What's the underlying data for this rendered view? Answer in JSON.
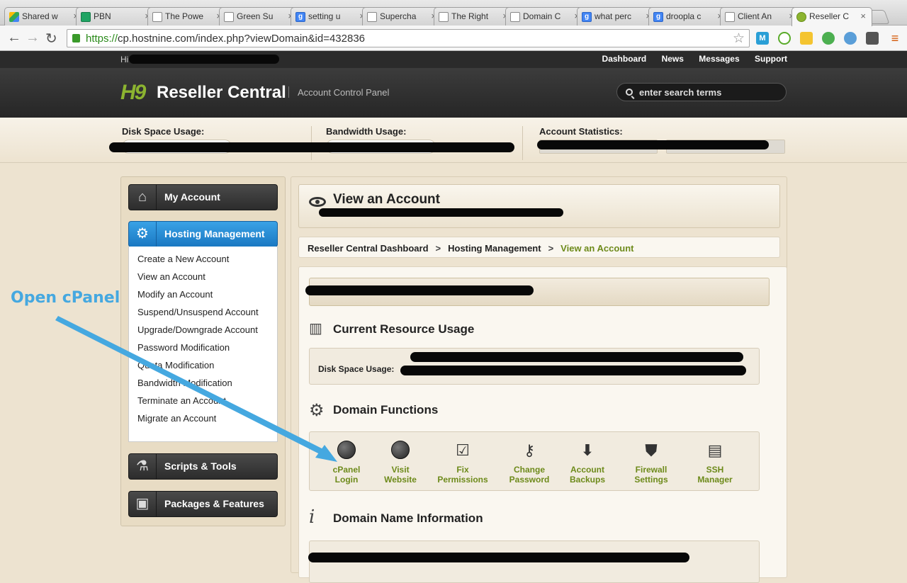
{
  "browser": {
    "tabs": [
      {
        "label": "Shared w",
        "icon": "drive-icon"
      },
      {
        "label": "PBN",
        "icon": "sheets-icon"
      },
      {
        "label": "The Powe",
        "icon": "page-icon"
      },
      {
        "label": "Green Su",
        "icon": "page-icon"
      },
      {
        "label": "setting u",
        "icon": "google-icon"
      },
      {
        "label": "Supercha",
        "icon": "page-icon"
      },
      {
        "label": "The Right",
        "icon": "page-icon"
      },
      {
        "label": "Domain C",
        "icon": "page-icon"
      },
      {
        "label": "what perc",
        "icon": "google-icon"
      },
      {
        "label": "droopla c",
        "icon": "google-icon"
      },
      {
        "label": "Client An",
        "icon": "page-icon"
      },
      {
        "label": "Reseller C",
        "icon": "cpanel-icon"
      }
    ],
    "url_scheme": "https://",
    "url_rest": "cp.hostnine.com/index.php?viewDomain&id=432836"
  },
  "site": {
    "greeting": "Hi th",
    "top_links": [
      "Dashboard",
      "News",
      "Messages",
      "Support"
    ],
    "logo": "H9",
    "brand": "Reseller Central",
    "subtitle": "Account Control Panel",
    "search_placeholder": "enter search terms"
  },
  "stats": {
    "disk_label": "Disk Space Usage:",
    "bandwidth_label": "Bandwidth Usage:",
    "account_label": "Account Statistics:"
  },
  "sidebar": {
    "my_account": "My Account",
    "hosting_management": "Hosting Management",
    "submenu": [
      "Create a New Account",
      "View an Account",
      "Modify an Account",
      "Suspend/Unsuspend Account",
      "Upgrade/Downgrade Account",
      "Password Modification",
      "Quota Modification",
      "Bandwidth Modification",
      "Terminate an Account",
      "Migrate an Account"
    ],
    "scripts_tools": "Scripts & Tools",
    "packages_features": "Packages & Features"
  },
  "main": {
    "title": "View an Account",
    "breadcrumb": [
      "Reseller Central Dashboard",
      "Hosting Management",
      "View an Account"
    ],
    "resource_title": "Current Resource Usage",
    "disk_usage_label": "Disk Space Usage:",
    "domain_functions_title": "Domain Functions",
    "functions": [
      {
        "line1": "cPanel",
        "line2": "Login",
        "icon": "globe-icon"
      },
      {
        "line1": "Visit",
        "line2": "Website",
        "icon": "globe-icon"
      },
      {
        "line1": "Fix",
        "line2": "Permissions",
        "icon": "checkbox-icon"
      },
      {
        "line1": "Change",
        "line2": "Password",
        "icon": "key-icon"
      },
      {
        "line1": "Account",
        "line2": "Backups",
        "icon": "download-icon"
      },
      {
        "line1": "Firewall",
        "line2": "Settings",
        "icon": "shield-icon"
      },
      {
        "line1": "SSH",
        "line2": "Manager",
        "icon": "terminal-icon"
      }
    ],
    "domain_info_title": "Domain Name Information"
  },
  "annotation": {
    "text": "Open cPanel",
    "color": "#45a8e0"
  },
  "colors": {
    "accent_green": "#6d8a1a",
    "active_blue": "#1a78c2",
    "header_dark": "#2b2b2b"
  }
}
